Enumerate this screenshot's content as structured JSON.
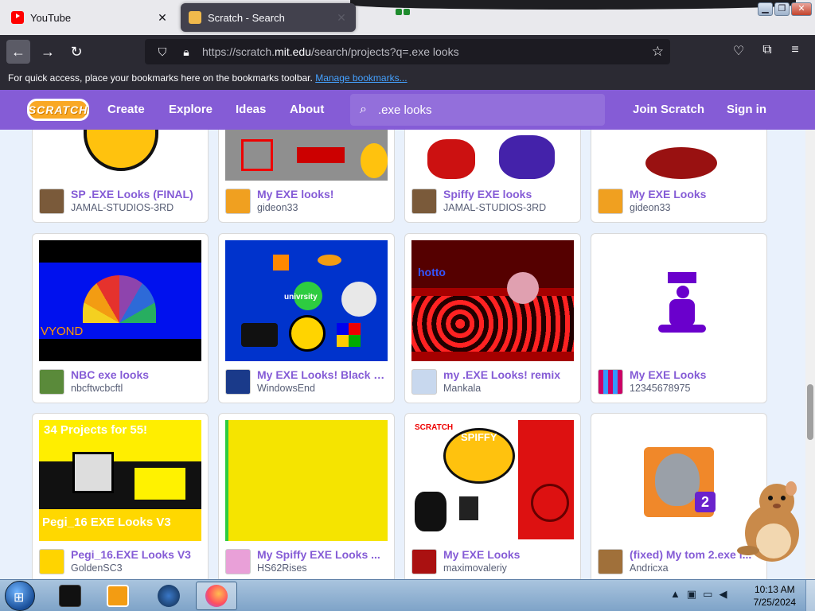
{
  "browser": {
    "tabs": [
      {
        "title": "YouTube",
        "close": "✕"
      },
      {
        "title": "Scratch - Search",
        "close": "✕"
      }
    ],
    "url_prefix": "https://scratch.",
    "url_host": "mit.edu",
    "url_path": "/search/projects?q=.exe looks",
    "bookmarks_text": "For quick access, place your bookmarks here on the bookmarks toolbar.",
    "bookmarks_link": "Manage bookmarks..."
  },
  "scratch": {
    "logo": "SCRATCH",
    "nav": [
      "Create",
      "Explore",
      "Ideas",
      "About"
    ],
    "search_value": ".exe looks",
    "join": "Join Scratch",
    "signin": "Sign in",
    "brand_color": "#855cd6"
  },
  "projects": [
    {
      "title": "SP .EXE Looks (FINAL)",
      "author": "JAMAL-STUDIOS-3RD"
    },
    {
      "title": "My EXE looks!",
      "author": "gideon33"
    },
    {
      "title": "Spiffy EXE looks",
      "author": "JAMAL-STUDIOS-3RD"
    },
    {
      "title": "My EXE Looks",
      "author": "gideon33"
    },
    {
      "title": "NBC exe looks",
      "author": "nbcftwcbcftl"
    },
    {
      "title": "My EXE Looks! Black Edition",
      "author": "WindowsEnd"
    },
    {
      "title": "my .EXE Looks! remix",
      "author": "Mankala"
    },
    {
      "title": "My EXE Looks",
      "author": "12345678975"
    },
    {
      "title": "Pegi_16.EXE Looks V3",
      "author": "GoldenSC3"
    },
    {
      "title": "My Spiffy EXE Looks ...",
      "author": "HS62Rises"
    },
    {
      "title": "My EXE Looks",
      "author": "maximovaleriy"
    },
    {
      "title": "(fixed) My tom 2.exe l...",
      "author": "Andricxa"
    }
  ],
  "thumb_text": {
    "vyond": "VYOND",
    "univrsity": "univrsity",
    "pegi_top": "34 Projects for 55!",
    "pegi_bottom": "Pegi_16 EXE Looks V3",
    "scratch": "SCRATCH",
    "spiffy": "SPIFFY",
    "tom_num": "2",
    "hotto": "hotto"
  },
  "taskbar": {
    "time": "10:13 AM",
    "date": "7/25/2024"
  }
}
